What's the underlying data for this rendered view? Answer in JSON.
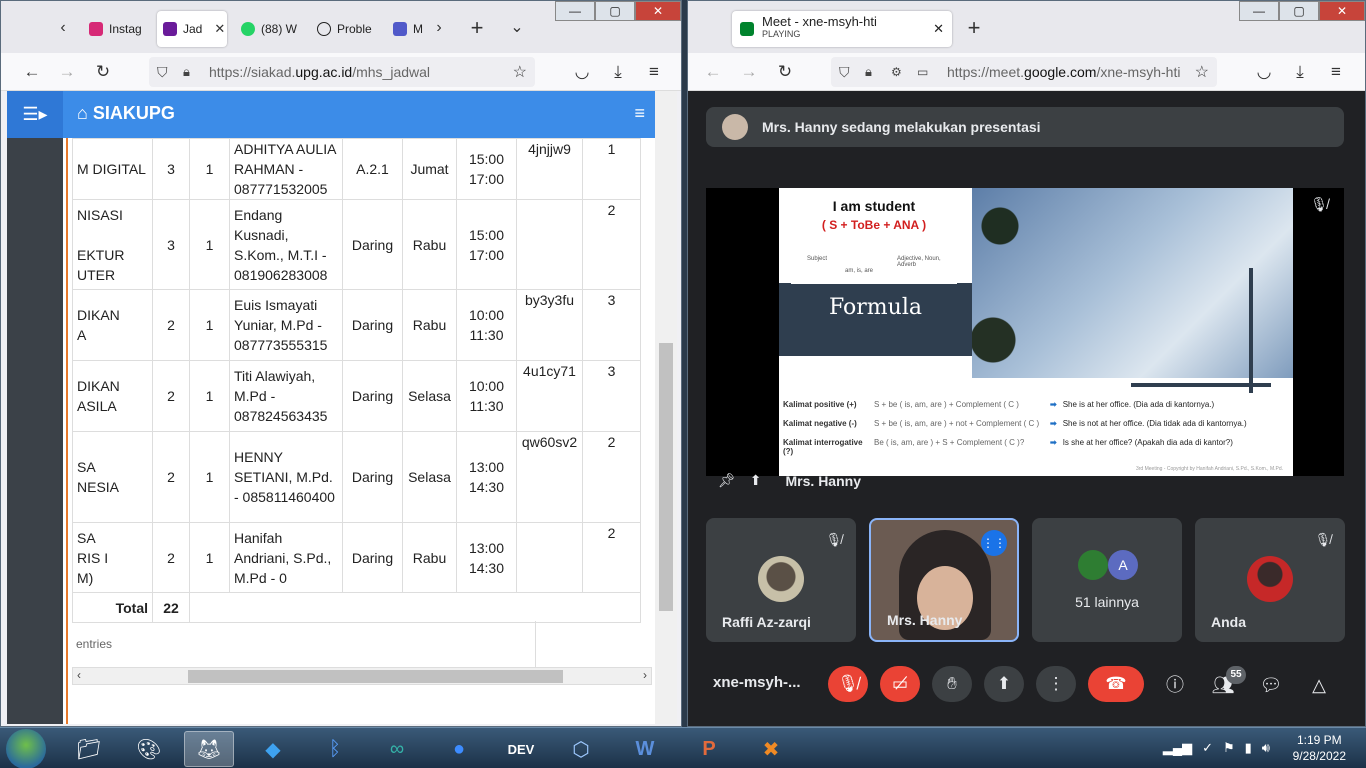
{
  "left_browser": {
    "tabs": [
      {
        "label": "Instag",
        "color": "#d62976"
      },
      {
        "label": "Jad",
        "color": "#6a1b9a"
      },
      {
        "label": "(88) W",
        "color": "#25d366"
      },
      {
        "label": "Proble",
        "color": "#222222"
      },
      {
        "label": "M",
        "color": "#5059c9"
      }
    ],
    "url_prefix": "https://siakad.",
    "url_host": "upg.ac.id",
    "url_path": "/mhs_jadwal"
  },
  "siakad": {
    "brand": "SIAKUPG",
    "rows": [
      {
        "course": [
          "M DIGITAL"
        ],
        "sks": "3",
        "kls": "1",
        "lecturer": "ADHITYA AULIA RAHMAN - 087771532005",
        "room": "A.2.1",
        "day": "Jumat",
        "time": [
          "15:00",
          "17:00"
        ],
        "code": "4jnjjw9",
        "sem": "1"
      },
      {
        "course": [
          "NISASI",
          "",
          "EKTUR",
          "UTER"
        ],
        "sks": "3",
        "kls": "1",
        "lecturer": "Endang Kusnadi, S.Kom., M.T.I - 081906283008",
        "room": "Daring",
        "day": "Rabu",
        "time": [
          "15:00",
          "17:00"
        ],
        "code": "",
        "sem": "2"
      },
      {
        "course": [
          "DIKAN",
          "A"
        ],
        "sks": "2",
        "kls": "1",
        "lecturer": "Euis Ismayati Yuniar, M.Pd - 087773555315",
        "room": "Daring",
        "day": "Rabu",
        "time": [
          "10:00",
          "11:30"
        ],
        "code": "by3y3fu",
        "sem": "3"
      },
      {
        "course": [
          "DIKAN",
          "ASILA"
        ],
        "sks": "2",
        "kls": "1",
        "lecturer": "Titi Alawiyah, M.Pd - 087824563435",
        "room": "Daring",
        "day": "Selasa",
        "time": [
          "10:00",
          "11:30"
        ],
        "code": "4u1cy71",
        "sem": "3"
      },
      {
        "course": [
          "SA",
          "NESIA"
        ],
        "sks": "2",
        "kls": "1",
        "lecturer": "HENNY SETIANI, M.Pd. - 085811460400",
        "room": "Daring",
        "day": "Selasa",
        "time": [
          "13:00",
          "14:30"
        ],
        "code": "qw60sv2",
        "sem": "2"
      },
      {
        "course": [
          "SA",
          "RIS I",
          "M)"
        ],
        "sks": "2",
        "kls": "1",
        "lecturer": "Hanifah Andriani, S.Pd., M.Pd - 0",
        "room": "Daring",
        "day": "Rabu",
        "time": [
          "13:00",
          "14:30"
        ],
        "code": "",
        "sem": "2"
      }
    ],
    "total_label": "Total",
    "total_value": "22",
    "entries_text": "entries"
  },
  "right_browser": {
    "tab_title": "Meet - xne-msyh-hti",
    "tab_status": "PLAYING",
    "url_prefix": "https://meet.",
    "url_host": "google.com",
    "url_path": "/xne-msyh-hti"
  },
  "meet": {
    "banner": "Mrs. Hanny sedang melakukan presentasi",
    "slide": {
      "heading": "I am student",
      "formula": "( S + ToBe + ANA )",
      "label_subject": "Subject",
      "label_tobe": "am, is, are",
      "label_ana": "Adjective, Noun, Adverb",
      "title": "Formula",
      "rows": [
        {
          "kind": "Kalimat positive (+)",
          "pattern": "S + be ( is, am, are ) + Complement ( C )",
          "example": "She is at her office. (Dia ada di kantornya.)"
        },
        {
          "kind": "Kalimat negative (-)",
          "pattern": "S + be ( is, am, are ) + not + Complement ( C )",
          "example": "She is not at her office. (Dia tidak ada di kantornya.)"
        },
        {
          "kind": "Kalimat interrogative (?)",
          "pattern": "Be ( is, am, are ) + S + Complement ( C )?",
          "example": "Is she at her office? (Apakah dia ada di kantor?)"
        }
      ],
      "copyright": "3rd Meeting - Copyright by Hanifah Andriani, S.Pd., S.Kom., M.Pd."
    },
    "presenter_name": "Mrs. Hanny",
    "tiles": [
      {
        "name": "Raffi Az-zarqi"
      },
      {
        "name": "Mrs. Hanny"
      },
      {
        "name": "51 lainnya",
        "avatar_letter": "A"
      },
      {
        "name": "Anda"
      }
    ],
    "meeting_code": "xne-msyh-...",
    "participants_count": "55"
  },
  "taskbar": {
    "time": "1:19 PM",
    "date": "9/28/2022"
  }
}
